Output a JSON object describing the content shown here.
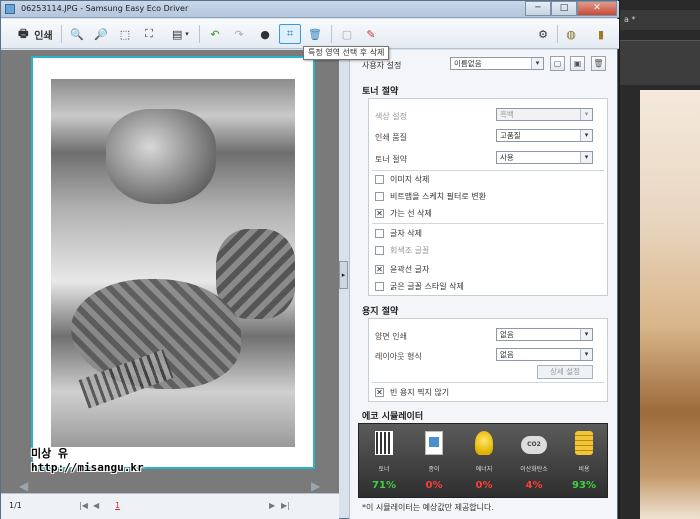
{
  "window": {
    "title": "06253114.JPG - Samsung Easy Eco Driver",
    "buttons": {
      "minimize": "─",
      "maximize": "□",
      "close": "✕"
    }
  },
  "toolbar": {
    "print_label": "인쇄",
    "tooltip": "특정 영역 선택 후 삭제"
  },
  "bottom": {
    "page_count": "1/1",
    "page_input": "1",
    "first": "|◀",
    "prev": "◀",
    "next": "▶",
    "last": "▶|"
  },
  "watermark": {
    "line1": "미상 유",
    "line2": "http://misangu.kr"
  },
  "panel": {
    "settings_label": "사용자 설정",
    "settings_value": "이름없음",
    "toner": {
      "header": "토너 절약",
      "color_label": "색상 설정",
      "color_value": "흑백",
      "quality_label": "인쇄 품질",
      "quality_value": "고품질",
      "toner_label": "토너 절약",
      "toner_value": "사용",
      "opt1": "이미지 삭제",
      "opt1_checked": false,
      "opt2": "비트맵을 스케치 필터로 변환",
      "opt2_checked": false,
      "opt3": "가는 선 삭제",
      "opt3_checked": true,
      "opt4": "글자 삭제",
      "opt4_checked": false,
      "opt5": "회색조 글꼴",
      "opt5_checked": false,
      "opt6": "윤곽선 글자",
      "opt6_checked": true,
      "opt7": "굵은 글꼴 스타일 삭제",
      "opt7_checked": false
    },
    "paper": {
      "header": "용지 절약",
      "duplex_label": "양면 인쇄",
      "duplex_value": "없음",
      "layout_label": "레이아웃 형식",
      "layout_value": "없음",
      "detail_button": "상세 설정",
      "skip_blank": "빈 용지 찍지 않기",
      "skip_blank_checked": true
    },
    "eco": {
      "header": "에코 시뮬레이터",
      "items": [
        {
          "label": "토너",
          "value": "71%",
          "color": "#3fd23f"
        },
        {
          "label": "종이",
          "value": "0%",
          "color": "#ff3c3c"
        },
        {
          "label": "에너지",
          "value": "0%",
          "color": "#ff3c3c"
        },
        {
          "label": "이산화탄소",
          "value": "4%",
          "color": "#ff3c3c"
        },
        {
          "label": "비용",
          "value": "93%",
          "color": "#3fd23f"
        }
      ],
      "note": "*이 시뮬레이터는 예상값만 제공합니다."
    }
  },
  "background_app": {
    "tab_label": "a *"
  }
}
